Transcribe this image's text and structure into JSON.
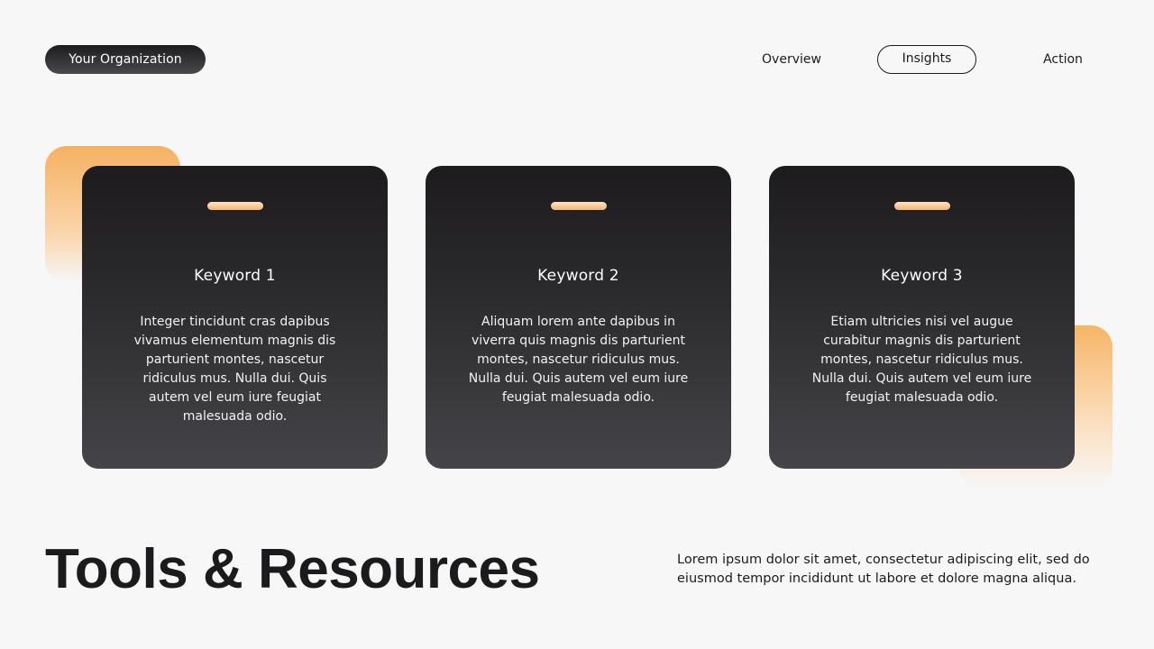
{
  "header": {
    "org_label": "Your Organization",
    "nav": [
      {
        "label": "Overview",
        "active": false
      },
      {
        "label": "Insights",
        "active": true
      },
      {
        "label": "Action",
        "active": false
      }
    ]
  },
  "cards": [
    {
      "title": "Keyword 1",
      "body": "Integer tincidunt cras dapibus vivamus elementum magnis dis parturient montes, nascetur ridiculus mus. Nulla dui. Quis autem vel eum iure feugiat malesuada odio."
    },
    {
      "title": "Keyword 2",
      "body": "Aliquam lorem ante dapibus in viverra quis magnis dis parturient montes, nascetur ridiculus mus. Nulla dui. Quis autem vel eum iure feugiat malesuada odio."
    },
    {
      "title": "Keyword 3",
      "body": "Etiam ultricies nisi vel augue curabitur magnis dis parturient montes, nascetur ridiculus mus. Nulla dui. Quis autem vel eum iure feugiat malesuada odio."
    }
  ],
  "footer": {
    "title": "Tools & Resources",
    "description": "Lorem ipsum dolor sit amet, consectetur adipiscing elit, sed do eiusmod tempor incididunt ut labore et dolore magna aliqua."
  },
  "colors": {
    "background": "#f7f7f8",
    "card_dark": "#1d1b1e",
    "accent_orange": "#f5b161",
    "text_dark": "#1b1a1c"
  }
}
